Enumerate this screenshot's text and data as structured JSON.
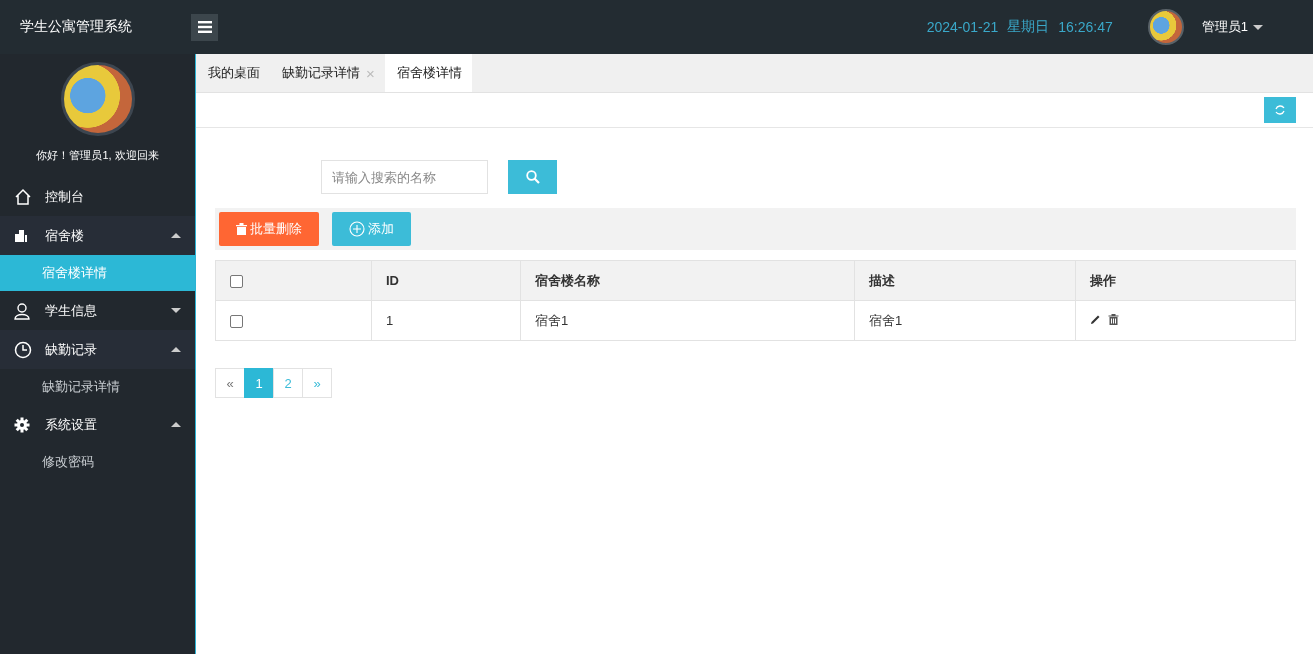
{
  "app_title": "学生公寓管理系统",
  "header": {
    "date": "2024-01-21",
    "weekday": "星期日",
    "time": "16:26:47",
    "user": "管理员1"
  },
  "sidebar": {
    "greeting": "你好！管理员1, 欢迎回来",
    "items": [
      {
        "label": "控制台"
      },
      {
        "label": "宿舍楼",
        "expanded": true,
        "children": [
          {
            "label": "宿舍楼详情",
            "selected": true
          }
        ]
      },
      {
        "label": "学生信息",
        "expanded": false
      },
      {
        "label": "缺勤记录",
        "expanded": true,
        "children": [
          {
            "label": "缺勤记录详情",
            "selected": false
          }
        ]
      },
      {
        "label": "系统设置",
        "expanded": true,
        "children": [
          {
            "label": "修改密码",
            "selected": false
          }
        ]
      }
    ]
  },
  "tabs": [
    {
      "label": "我的桌面",
      "selected": false
    },
    {
      "label": "缺勤记录详情",
      "selected": false,
      "close": "×"
    },
    {
      "label": "宿舍楼详情",
      "selected": true
    }
  ],
  "search": {
    "placeholder": "请输入搜索的名称"
  },
  "toolbar": {
    "delete_label": "批量删除",
    "add_label": "添加"
  },
  "table": {
    "header_checked": false,
    "columns": [
      "ID",
      "宿舍楼名称",
      "描述",
      "操作"
    ],
    "rows": [
      {
        "checked": false,
        "cells": [
          "1",
          "宿舍1",
          "宿舍1"
        ]
      }
    ]
  },
  "pagination": [
    {
      "label": "«",
      "selected": false
    },
    {
      "label": "1",
      "selected": true
    },
    {
      "label": "2",
      "selected": false
    },
    {
      "label": "»",
      "selected": false
    }
  ]
}
